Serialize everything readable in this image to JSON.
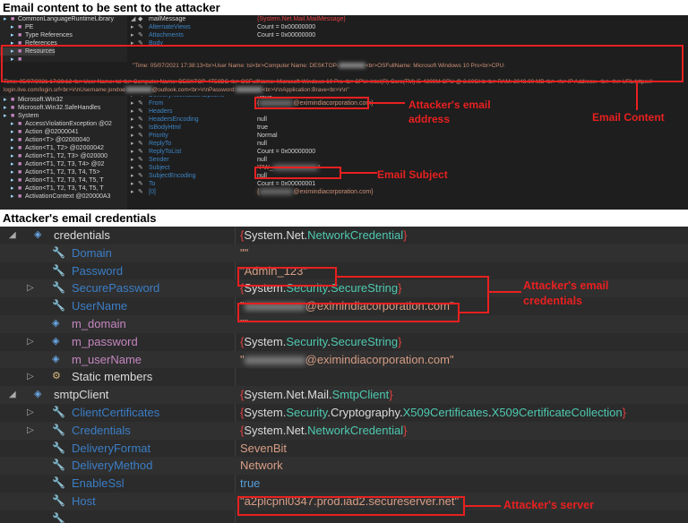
{
  "headings": {
    "top": "Email content to be sent to the attacker",
    "bottom": "Attacker's email credentials"
  },
  "top_tree": [
    "CommonLanguageRuntimeLibrary",
    "PE",
    "Type References",
    "References",
    "Resources",
    "",
    "",
    "",
    "",
    "",
    "Microsoft.Win32",
    "Microsoft.Win32.SafeHandles",
    "System",
    "AccessViolationException @02",
    "Action @02000041",
    "Action<T> @02000040",
    "Action<T1, T2> @02000042",
    "Action<T1, T2, T3> @020000",
    "Action<T1, T2, T3, T4> @02",
    "Action<T1, T2, T3, T4, T5>",
    "Action<T1, T2, T3, T4, T5, T",
    "Action<T1, T2, T3, T4, T5, T",
    "ActivationContext @020000A3"
  ],
  "top_grid": {
    "header": {
      "name": "mailMessage",
      "value": "{System.Net.Mail.MailMessage}"
    },
    "rows": [
      {
        "name": "AlternateViews",
        "value": "Count = 0x00000000"
      },
      {
        "name": "Attachments",
        "value": "Count = 0x00000000"
      },
      {
        "name": "Body",
        "value": ""
      },
      {
        "name": "",
        "value": ""
      },
      {
        "name": "",
        "value": ""
      },
      {
        "name": "",
        "value": ""
      },
      {
        "name": "DeliveryNotificationOptions",
        "value": "None"
      },
      {
        "name": "From",
        "value": "@eximindiacorporation.com}"
      },
      {
        "name": "Headers",
        "value": ""
      },
      {
        "name": "HeadersEncoding",
        "value": "null"
      },
      {
        "name": "IsBodyHtml",
        "value": "true"
      },
      {
        "name": "Priority",
        "value": "Normal"
      },
      {
        "name": "ReplyTo",
        "value": "null"
      },
      {
        "name": "ReplyToList",
        "value": "Count = 0x00000000"
      },
      {
        "name": "Sender",
        "value": "null"
      },
      {
        "name": "Subject",
        "value": "\"PW_"
      },
      {
        "name": "SubjectEncoding",
        "value": "null"
      },
      {
        "name": "To",
        "value": "Count = 0x00000001"
      },
      {
        "name": "[0]",
        "value": "@eximindiacorporation.com}"
      }
    ],
    "body_line1": "\"Time: 05/07/2021 17:38:13<br>User Name: tsl<br>Computer Name: DESKTOP-",
    "body_line1b": "<br>OSFullName: Microsoft Windows 10 Pro<br>CPU:",
    "body_line2": "Time: 05/07/2021 17:38:13<br>User Name: tsl<br>Computer Name: DESKTOP-4T58BG<br>OSFullName: Microsoft Windows 10 Pro<br>CPU: Intel(R) Core(TM) i5-4300M CPU @ 2.60GHz<br>RAM: 2048.00 MB<br><hr>IP Address: <br><hr>URL:https://",
    "body_line3": "login.live.com/login.srf<br>\\r\\nUsername:jondoe",
    "body_line3b": "@outlook.com<br>\\r\\nPassword:",
    "body_line3c": "<br>\\r\\nApplication:Brave<br>\\r\\n\""
  },
  "bottom_rows": [
    {
      "name": "credentials",
      "value": "{System.Net.NetworkCredential}"
    },
    {
      "name": "Domain",
      "value": "\"\""
    },
    {
      "name": "Password",
      "value": "\"Admin_123\""
    },
    {
      "name": "SecurePassword",
      "value": "{System.Security.SecureString}"
    },
    {
      "name": "UserName",
      "value": "@eximindiacorporation.com\""
    },
    {
      "name": "m_domain",
      "value": "\"\""
    },
    {
      "name": "m_password",
      "value": "{System.Security.SecureString}"
    },
    {
      "name": "m_userName",
      "value": "@eximindiacorporation.com\""
    },
    {
      "name": "Static members",
      "value": ""
    },
    {
      "name": "smtpClient",
      "value": "{System.Net.Mail.SmtpClient}"
    },
    {
      "name": "ClientCertificates",
      "value": "{System.Security.Cryptography.X509Certificates.X509CertificateCollection}"
    },
    {
      "name": "Credentials",
      "value": "{System.Net.NetworkCredential}"
    },
    {
      "name": "DeliveryFormat",
      "value": "SevenBit"
    },
    {
      "name": "DeliveryMethod",
      "value": "Network"
    },
    {
      "name": "EnableSsl",
      "value": "true"
    },
    {
      "name": "Host",
      "value": "\"a2plcpnl0347.prod.iad2.secureserver.net\""
    },
    {
      "name": "",
      "value": ""
    }
  ],
  "annotations": {
    "attacker_email": "Attacker's email",
    "attacker_email2": "address",
    "email_content": "Email Content",
    "email_subject": "Email Subject",
    "attacker_creds": "Attacker's email",
    "attacker_creds2": "credentials",
    "attacker_server": "Attacker's server"
  },
  "colors": {
    "annotation_red": "#e82020",
    "panel_bg": "#2b2b2b",
    "property_blue": "#3b7ec6",
    "string_value": "#d69d85"
  }
}
